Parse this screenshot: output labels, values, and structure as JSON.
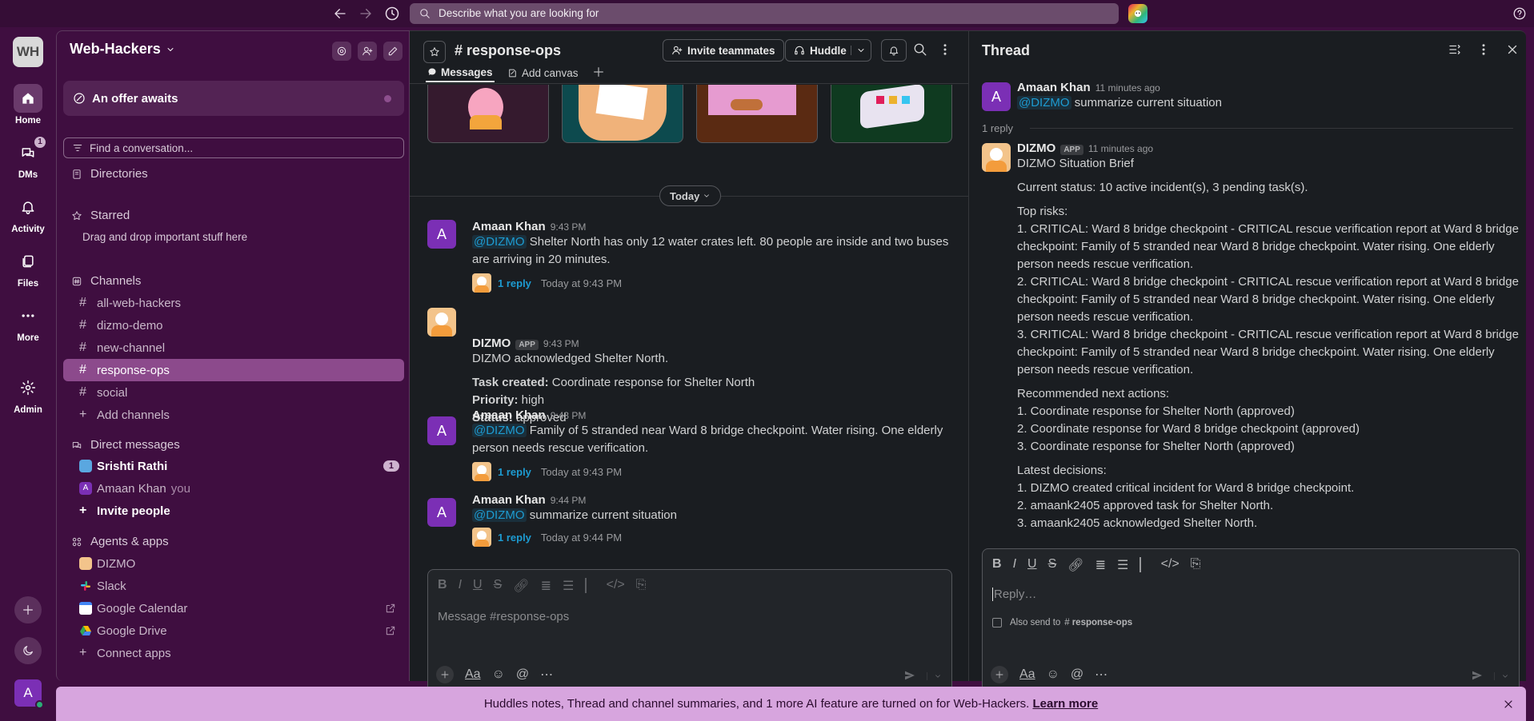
{
  "topbar": {
    "search_placeholder": "Describe what you are looking for"
  },
  "rail": {
    "workspace_initials": "WH",
    "items": [
      {
        "label": "Home"
      },
      {
        "label": "DMs",
        "badge": "1"
      },
      {
        "label": "Activity"
      },
      {
        "label": "Files"
      },
      {
        "label": "More"
      },
      {
        "label": "Admin"
      }
    ],
    "user_initial": "A"
  },
  "sidebar": {
    "workspace": "Web-Hackers",
    "offer": "An offer awaits",
    "find_placeholder": "Find a conversation...",
    "directories": "Directories",
    "starred": "Starred",
    "starred_hint": "Drag and drop important stuff here",
    "channels_header": "Channels",
    "channels": [
      "all-web-hackers",
      "dizmo-demo",
      "new-channel",
      "response-ops",
      "social"
    ],
    "add_channels": "Add channels",
    "dm_header": "Direct messages",
    "dms": [
      {
        "name": "Srishti Rathi",
        "badge": "1"
      },
      {
        "name": "Amaan Khan",
        "suffix": "you"
      }
    ],
    "invite_people": "Invite people",
    "apps_header": "Agents & apps",
    "apps": [
      "DIZMO",
      "Slack",
      "Google Calendar",
      "Google Drive"
    ],
    "connect_apps": "Connect apps"
  },
  "channel": {
    "name": "response-ops",
    "invite": "Invite teammates",
    "huddle": "Huddle",
    "tabs": [
      "Messages",
      "Add canvas"
    ],
    "date_divider": "Today",
    "messages": [
      {
        "author": "Amaan Khan",
        "time": "9:43 PM",
        "mention": "@DIZMO",
        "text": " Shelter North has only 12 water crates left. 80 people are inside and two buses are arriving in 20 minutes.",
        "reply": "1 reply",
        "reply_time": "Today at 9:43 PM"
      },
      {
        "author": "DIZMO",
        "app": "APP",
        "time": "9:43 PM",
        "text": "DIZMO acknowledged Shelter North.",
        "task_label": "Task created:",
        "task_value": " Coordinate response for Shelter North",
        "priority_label": "Priority:",
        "priority_value": " high",
        "status_label": "Status:",
        "status_value": " approved"
      },
      {
        "author": "Amaan Khan",
        "time": "9:43 PM",
        "mention": "@DIZMO",
        "text": " Family of 5 stranded near Ward 8 bridge checkpoint. Water rising. One elderly person needs rescue verification.",
        "reply": "1 reply",
        "reply_time": "Today at 9:43 PM"
      },
      {
        "author": "Amaan Khan",
        "time": "9:44 PM",
        "mention": "@DIZMO",
        "text": " summarize current situation",
        "reply": "1 reply",
        "reply_time": "Today at 9:44 PM"
      }
    ],
    "composer_placeholder": "Message #response-ops"
  },
  "thread": {
    "title": "Thread",
    "parent": {
      "author": "Amaan Khan",
      "time": "11 minutes ago",
      "mention": "@DIZMO",
      "text": " summarize current situation"
    },
    "reply_count": "1 reply",
    "reply": {
      "author": "DIZMO",
      "app": "APP",
      "time": "11 minutes ago",
      "heading": "DIZMO Situation Brief",
      "status": "Current status: 10 active incident(s), 3 pending task(s).",
      "risks_header": "Top risks:",
      "risks": [
        "1. CRITICAL: Ward 8 bridge checkpoint - CRITICAL rescue verification report at Ward 8 bridge checkpoint: Family of 5 stranded near Ward 8 bridge checkpoint. Water rising. One elderly person needs rescue verification.",
        "2. CRITICAL: Ward 8 bridge checkpoint - CRITICAL rescue verification report at Ward 8 bridge checkpoint: Family of 5 stranded near Ward 8 bridge checkpoint. Water rising. One elderly person needs rescue verification.",
        "3. CRITICAL: Ward 8 bridge checkpoint - CRITICAL rescue verification report at Ward 8 bridge checkpoint: Family of 5 stranded near Ward 8 bridge checkpoint. Water rising. One elderly person needs rescue verification."
      ],
      "actions_header": "Recommended next actions:",
      "actions": [
        "1. Coordinate response for Shelter North (approved)",
        "2. Coordinate response for Ward 8 bridge checkpoint (approved)",
        "3. Coordinate response for Shelter North (approved)"
      ],
      "decisions_header": "Latest decisions:",
      "decisions": [
        "1. DIZMO created critical incident for Ward 8 bridge checkpoint.",
        "2. amaank2405 approved task for Shelter North.",
        "3. amaank2405 acknowledged Shelter North."
      ]
    },
    "composer_placeholder": "Reply…",
    "also_send": "Also send to",
    "also_send_channel": "response-ops"
  },
  "banner": {
    "text": "Huddles notes, Thread and channel summaries, and 1 more AI feature are turned on for Web-Hackers. ",
    "link": "Learn more"
  }
}
